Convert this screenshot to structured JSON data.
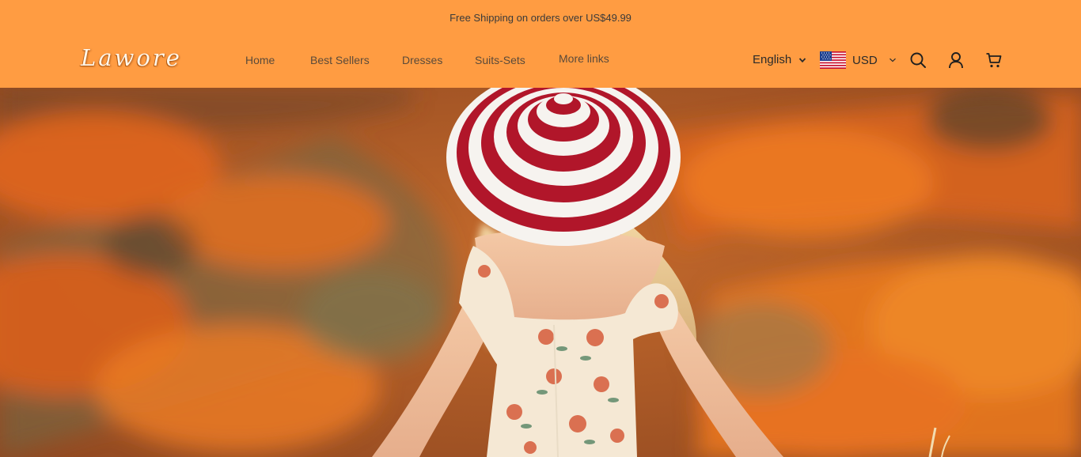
{
  "announcement": {
    "text": "Free Shipping on orders over US$49.99"
  },
  "brand": {
    "logo_text": "Lawore"
  },
  "nav": {
    "items": [
      {
        "label": "Home"
      },
      {
        "label": "Best Sellers"
      },
      {
        "label": "Dresses"
      },
      {
        "label": "Suits-Sets"
      },
      {
        "label": "More links"
      }
    ]
  },
  "locale": {
    "language": "English",
    "currency": "USD",
    "flag_icon": "us-flag-icon"
  },
  "actions": {
    "search_icon": "search-icon",
    "account_icon": "user-icon",
    "cart_icon": "cart-icon"
  },
  "hero": {
    "image_icon": "hero-image"
  },
  "colors": {
    "header_bg": "#ff9c42",
    "text_dark": "#2a2a2a",
    "nav_text": "#5a4a3a"
  }
}
